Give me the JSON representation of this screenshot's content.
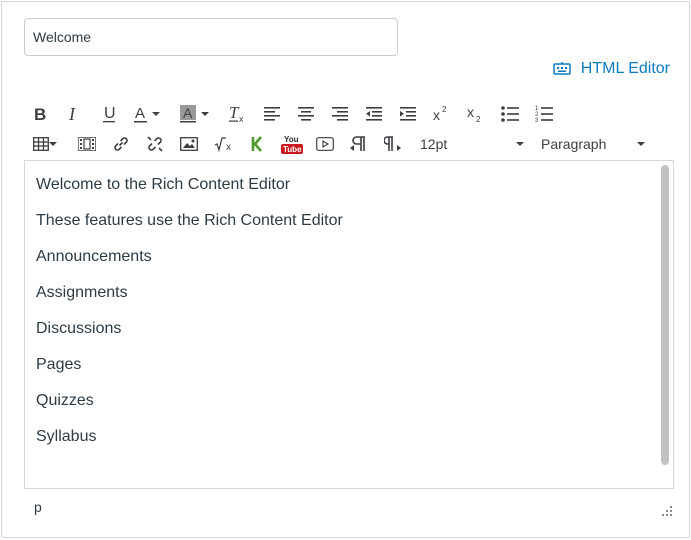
{
  "title_field": {
    "value": "Welcome"
  },
  "html_editor_link": {
    "label": "HTML Editor"
  },
  "toolbar": {
    "row1": [
      "bold-icon",
      "italic-icon",
      "underline-icon",
      "text-color-icon",
      "background-color-icon",
      "clear-formatting-icon",
      "align-left-icon",
      "align-center-icon",
      "align-right-icon",
      "outdent-icon",
      "indent-icon",
      "superscript-icon",
      "subscript-icon",
      "bullet-list-icon",
      "numbered-list-icon"
    ],
    "row2": [
      "table-icon",
      "media-icon",
      "link-icon",
      "unlink-icon",
      "image-icon",
      "equation-icon",
      "kaltura-icon",
      "youtube-icon",
      "video-icon",
      "ltr-icon",
      "rtl-icon"
    ],
    "font_size": "12pt",
    "block_format": "Paragraph",
    "youtube_text": {
      "top": "You",
      "bottom": "Tube"
    }
  },
  "content": {
    "paragraphs": [
      "Welcome to the Rich Content Editor",
      "These features use the Rich Content Editor",
      "Announcements",
      "Assignments",
      "Discussions",
      "Pages",
      "Quizzes",
      "Syllabus"
    ]
  },
  "statusbar": {
    "path": "p"
  },
  "colors": {
    "link": "#0c7bc2",
    "text": "#2d3b45",
    "kaltura": "#4d9a2a",
    "youtube": "#cc181e"
  }
}
